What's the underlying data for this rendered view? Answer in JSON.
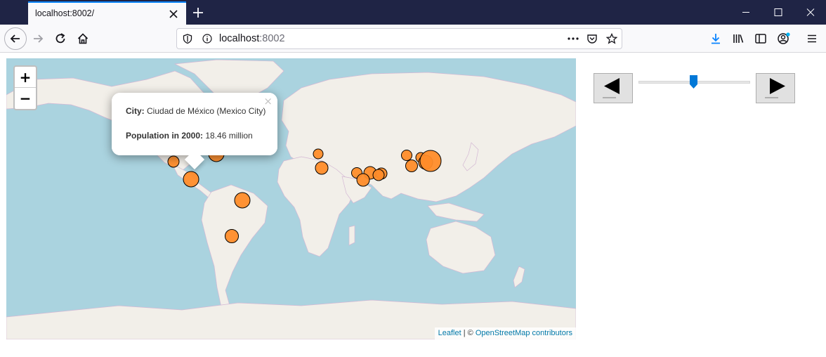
{
  "browser": {
    "tab_title": "localhost:8002/",
    "url_host": "localhost",
    "url_port": ":8002"
  },
  "map": {
    "zoom_in_label": "+",
    "zoom_out_label": "−",
    "popup": {
      "city_label": "City:",
      "city_value": "Ciudad de México (Mexico City)",
      "population_label": "Population in 2000:",
      "population_value": "18.46 million",
      "close_glyph": "×"
    },
    "attribution": {
      "leaflet": "Leaflet",
      "separator": " | © ",
      "osm": "OpenStreetMap contributors"
    }
  },
  "player": {
    "slider_value_fraction": 0.49
  },
  "colors": {
    "bubble_fill": "#ff8c2a",
    "ocean": "#aad3df",
    "land": "#f2efe9",
    "accent": "#0a84ff"
  }
}
